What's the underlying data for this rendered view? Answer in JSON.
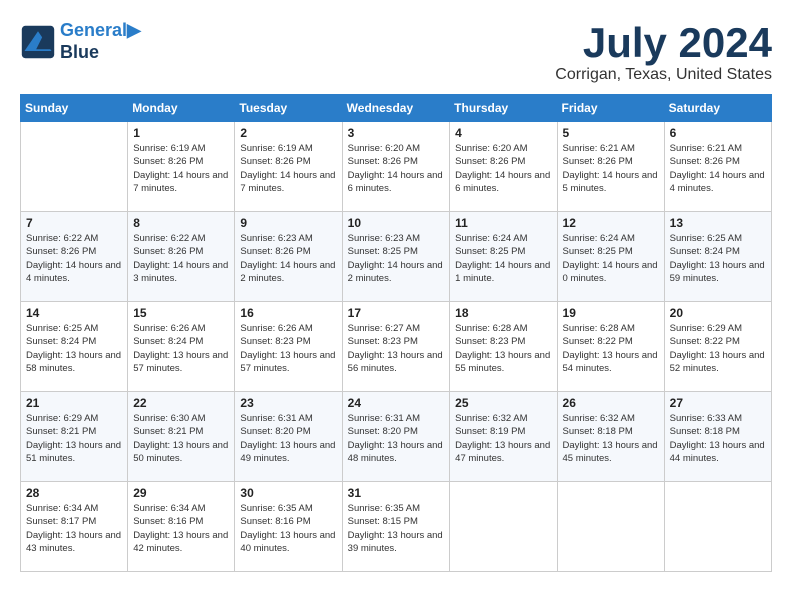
{
  "header": {
    "logo_line1": "General",
    "logo_line2": "Blue",
    "month": "July 2024",
    "location": "Corrigan, Texas, United States"
  },
  "days_of_week": [
    "Sunday",
    "Monday",
    "Tuesday",
    "Wednesday",
    "Thursday",
    "Friday",
    "Saturday"
  ],
  "weeks": [
    [
      {
        "day": "",
        "sunrise": "",
        "sunset": "",
        "daylight": ""
      },
      {
        "day": "1",
        "sunrise": "Sunrise: 6:19 AM",
        "sunset": "Sunset: 8:26 PM",
        "daylight": "Daylight: 14 hours and 7 minutes."
      },
      {
        "day": "2",
        "sunrise": "Sunrise: 6:19 AM",
        "sunset": "Sunset: 8:26 PM",
        "daylight": "Daylight: 14 hours and 7 minutes."
      },
      {
        "day": "3",
        "sunrise": "Sunrise: 6:20 AM",
        "sunset": "Sunset: 8:26 PM",
        "daylight": "Daylight: 14 hours and 6 minutes."
      },
      {
        "day": "4",
        "sunrise": "Sunrise: 6:20 AM",
        "sunset": "Sunset: 8:26 PM",
        "daylight": "Daylight: 14 hours and 6 minutes."
      },
      {
        "day": "5",
        "sunrise": "Sunrise: 6:21 AM",
        "sunset": "Sunset: 8:26 PM",
        "daylight": "Daylight: 14 hours and 5 minutes."
      },
      {
        "day": "6",
        "sunrise": "Sunrise: 6:21 AM",
        "sunset": "Sunset: 8:26 PM",
        "daylight": "Daylight: 14 hours and 4 minutes."
      }
    ],
    [
      {
        "day": "7",
        "sunrise": "Sunrise: 6:22 AM",
        "sunset": "Sunset: 8:26 PM",
        "daylight": "Daylight: 14 hours and 4 minutes."
      },
      {
        "day": "8",
        "sunrise": "Sunrise: 6:22 AM",
        "sunset": "Sunset: 8:26 PM",
        "daylight": "Daylight: 14 hours and 3 minutes."
      },
      {
        "day": "9",
        "sunrise": "Sunrise: 6:23 AM",
        "sunset": "Sunset: 8:26 PM",
        "daylight": "Daylight: 14 hours and 2 minutes."
      },
      {
        "day": "10",
        "sunrise": "Sunrise: 6:23 AM",
        "sunset": "Sunset: 8:25 PM",
        "daylight": "Daylight: 14 hours and 2 minutes."
      },
      {
        "day": "11",
        "sunrise": "Sunrise: 6:24 AM",
        "sunset": "Sunset: 8:25 PM",
        "daylight": "Daylight: 14 hours and 1 minute."
      },
      {
        "day": "12",
        "sunrise": "Sunrise: 6:24 AM",
        "sunset": "Sunset: 8:25 PM",
        "daylight": "Daylight: 14 hours and 0 minutes."
      },
      {
        "day": "13",
        "sunrise": "Sunrise: 6:25 AM",
        "sunset": "Sunset: 8:24 PM",
        "daylight": "Daylight: 13 hours and 59 minutes."
      }
    ],
    [
      {
        "day": "14",
        "sunrise": "Sunrise: 6:25 AM",
        "sunset": "Sunset: 8:24 PM",
        "daylight": "Daylight: 13 hours and 58 minutes."
      },
      {
        "day": "15",
        "sunrise": "Sunrise: 6:26 AM",
        "sunset": "Sunset: 8:24 PM",
        "daylight": "Daylight: 13 hours and 57 minutes."
      },
      {
        "day": "16",
        "sunrise": "Sunrise: 6:26 AM",
        "sunset": "Sunset: 8:23 PM",
        "daylight": "Daylight: 13 hours and 57 minutes."
      },
      {
        "day": "17",
        "sunrise": "Sunrise: 6:27 AM",
        "sunset": "Sunset: 8:23 PM",
        "daylight": "Daylight: 13 hours and 56 minutes."
      },
      {
        "day": "18",
        "sunrise": "Sunrise: 6:28 AM",
        "sunset": "Sunset: 8:23 PM",
        "daylight": "Daylight: 13 hours and 55 minutes."
      },
      {
        "day": "19",
        "sunrise": "Sunrise: 6:28 AM",
        "sunset": "Sunset: 8:22 PM",
        "daylight": "Daylight: 13 hours and 54 minutes."
      },
      {
        "day": "20",
        "sunrise": "Sunrise: 6:29 AM",
        "sunset": "Sunset: 8:22 PM",
        "daylight": "Daylight: 13 hours and 52 minutes."
      }
    ],
    [
      {
        "day": "21",
        "sunrise": "Sunrise: 6:29 AM",
        "sunset": "Sunset: 8:21 PM",
        "daylight": "Daylight: 13 hours and 51 minutes."
      },
      {
        "day": "22",
        "sunrise": "Sunrise: 6:30 AM",
        "sunset": "Sunset: 8:21 PM",
        "daylight": "Daylight: 13 hours and 50 minutes."
      },
      {
        "day": "23",
        "sunrise": "Sunrise: 6:31 AM",
        "sunset": "Sunset: 8:20 PM",
        "daylight": "Daylight: 13 hours and 49 minutes."
      },
      {
        "day": "24",
        "sunrise": "Sunrise: 6:31 AM",
        "sunset": "Sunset: 8:20 PM",
        "daylight": "Daylight: 13 hours and 48 minutes."
      },
      {
        "day": "25",
        "sunrise": "Sunrise: 6:32 AM",
        "sunset": "Sunset: 8:19 PM",
        "daylight": "Daylight: 13 hours and 47 minutes."
      },
      {
        "day": "26",
        "sunrise": "Sunrise: 6:32 AM",
        "sunset": "Sunset: 8:18 PM",
        "daylight": "Daylight: 13 hours and 45 minutes."
      },
      {
        "day": "27",
        "sunrise": "Sunrise: 6:33 AM",
        "sunset": "Sunset: 8:18 PM",
        "daylight": "Daylight: 13 hours and 44 minutes."
      }
    ],
    [
      {
        "day": "28",
        "sunrise": "Sunrise: 6:34 AM",
        "sunset": "Sunset: 8:17 PM",
        "daylight": "Daylight: 13 hours and 43 minutes."
      },
      {
        "day": "29",
        "sunrise": "Sunrise: 6:34 AM",
        "sunset": "Sunset: 8:16 PM",
        "daylight": "Daylight: 13 hours and 42 minutes."
      },
      {
        "day": "30",
        "sunrise": "Sunrise: 6:35 AM",
        "sunset": "Sunset: 8:16 PM",
        "daylight": "Daylight: 13 hours and 40 minutes."
      },
      {
        "day": "31",
        "sunrise": "Sunrise: 6:35 AM",
        "sunset": "Sunset: 8:15 PM",
        "daylight": "Daylight: 13 hours and 39 minutes."
      },
      {
        "day": "",
        "sunrise": "",
        "sunset": "",
        "daylight": ""
      },
      {
        "day": "",
        "sunrise": "",
        "sunset": "",
        "daylight": ""
      },
      {
        "day": "",
        "sunrise": "",
        "sunset": "",
        "daylight": ""
      }
    ]
  ]
}
